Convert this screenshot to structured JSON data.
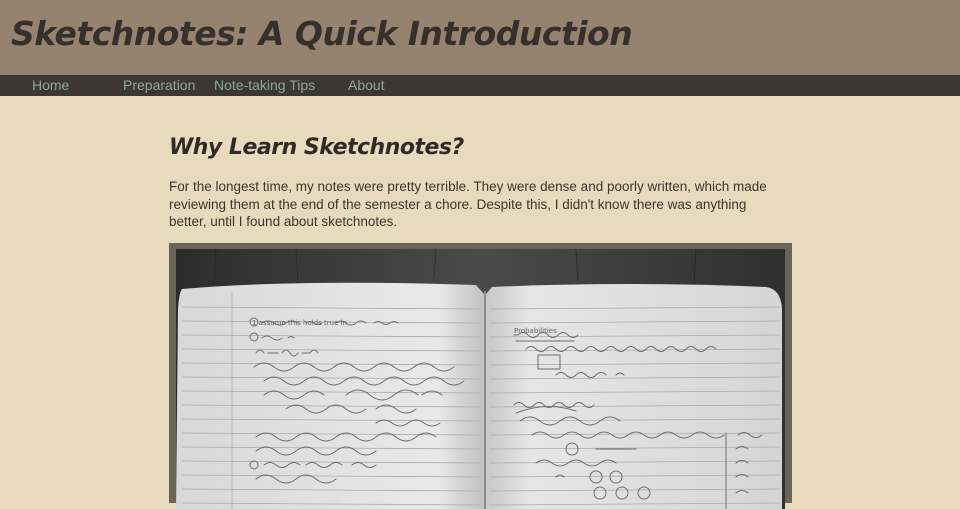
{
  "header": {
    "title": "Sketchnotes: A Quick Introduction"
  },
  "nav": {
    "items": [
      {
        "label": "Home"
      },
      {
        "label": "Preparation"
      },
      {
        "label": "Note-taking Tips"
      },
      {
        "label": "About"
      }
    ]
  },
  "main": {
    "heading": "Why Learn Sketchnotes?",
    "intro": "For the longest time, my notes were pretty terrible. They were dense and poorly written, which made reviewing them at the end of the semester a chore. Despite this, I didn't know there was anything better, until I found about sketchnotes.",
    "photo": {
      "icon": "notebook-photo",
      "page_left_heading": "1 assume this holds true in",
      "page_right_heading": "Probabilities"
    }
  },
  "colors": {
    "header_bg": "#958370",
    "nav_bg": "#3a3734",
    "nav_link": "#8faa8e",
    "page_bg": "#e8dabd",
    "title_text": "#35302b",
    "frame": "#6b6258"
  }
}
